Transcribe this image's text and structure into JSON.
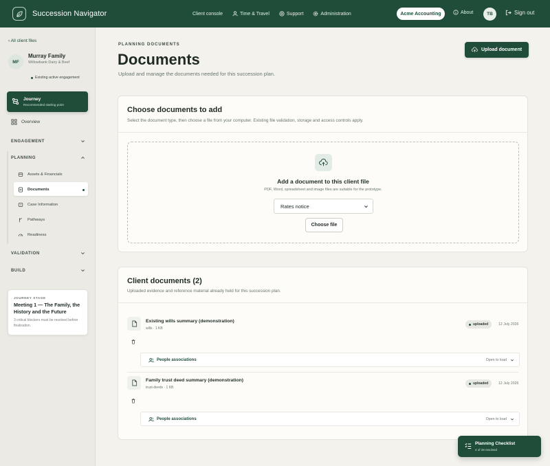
{
  "app": {
    "title": "Succession Navigator"
  },
  "topnav": {
    "client_console": "Client console",
    "time_travel": "Time & Travel",
    "support": "Support",
    "administration": "Administration",
    "account": "Acme Accounting",
    "about": "About",
    "user_initials": "TB",
    "sign_out": "Sign out"
  },
  "sidebar": {
    "back_link": "All client files",
    "client": {
      "initials": "MF",
      "name": "Murray Family",
      "subtitle": "Willowbank Dairy & Beef",
      "status": "Existing active engagement"
    },
    "journey": {
      "title": "Journey",
      "subtitle": "Recommended starting point"
    },
    "overview": "Overview",
    "sections": {
      "engagement": "ENGAGEMENT",
      "planning": "PLANNING",
      "validation": "VALIDATION",
      "build": "BUILD"
    },
    "planning_items": [
      {
        "label": "Assets & Financials"
      },
      {
        "label": "Documents"
      },
      {
        "label": "Case Information"
      },
      {
        "label": "Pathways"
      },
      {
        "label": "Readiness"
      }
    ],
    "stage": {
      "label": "JOURNEY STAGE",
      "title": "Meeting 1 — The Family, the History and the Future",
      "note": "3 critical blockers must be resolved before finalisation."
    }
  },
  "page": {
    "kicker": "PLANNING DOCUMENTS",
    "title": "Documents",
    "subtitle": "Upload and manage the documents needed for this succession plan.",
    "upload_button": "Upload document"
  },
  "choose": {
    "title": "Choose documents to add",
    "subtitle": "Select the document type, then choose a file from your computer. Existing file validation, storage and access controls apply.",
    "drop_title": "Add a document to this client file",
    "drop_sub": "PDF, Word, spreadsheet and image files are suitable for the prototype.",
    "doc_type_selected": "Rates notice",
    "choose_file": "Choose file"
  },
  "client_docs": {
    "title": "Client documents (2)",
    "subtitle": "Uploaded evidence and reference material already held for this succession plan.",
    "items": [
      {
        "title": "Existing wills summary (demonstration)",
        "meta": "wills · 1 KB",
        "status": "uploaded",
        "date": "12 July 2026",
        "assoc_label": "People associations",
        "assoc_action": "Open to load"
      },
      {
        "title": "Family trust deed summary (demonstration)",
        "meta": "trust-deeds · 1 KB",
        "status": "uploaded",
        "date": "12 July 2026",
        "assoc_label": "People associations",
        "assoc_action": "Open to load"
      }
    ]
  },
  "checklist": {
    "title": "Planning Checklist",
    "subtitle": "4 of 28 resolved"
  },
  "colors": {
    "brand": "#1f4d3a",
    "background": "#f3f2ec"
  }
}
